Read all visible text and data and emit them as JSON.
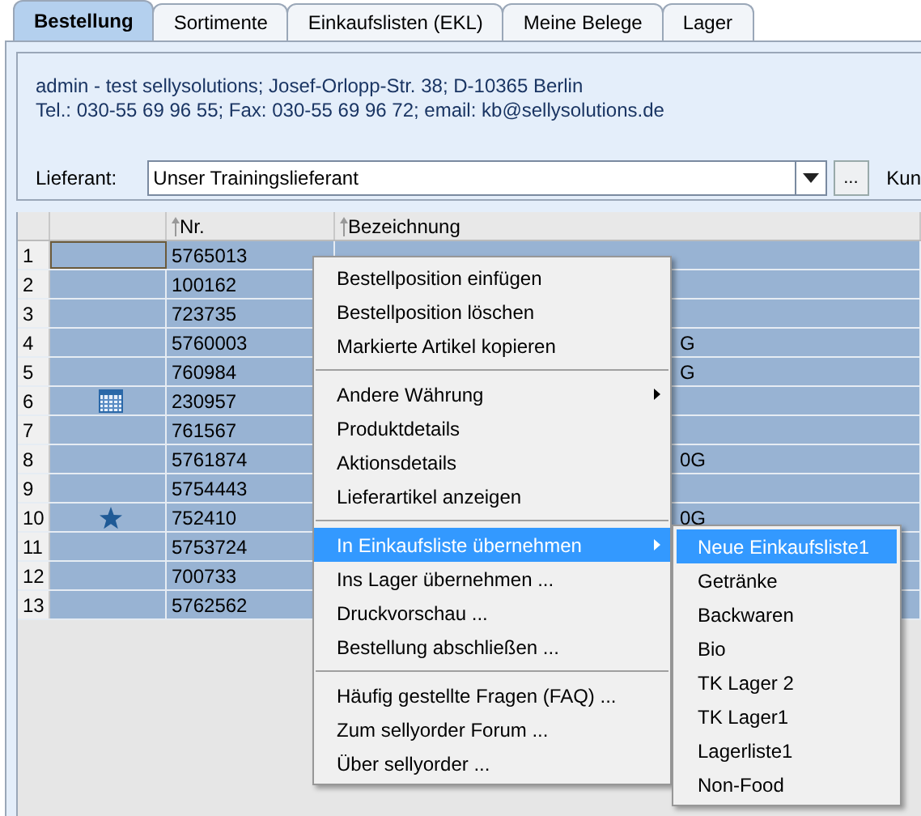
{
  "tabs": [
    {
      "label": "Bestellung",
      "selected": true
    },
    {
      "label": "Sortimente",
      "selected": false
    },
    {
      "label": "Einkaufslisten (EKL)",
      "selected": false
    },
    {
      "label": "Meine Belege",
      "selected": false
    },
    {
      "label": "Lager",
      "selected": false
    }
  ],
  "address_lines": [
    "admin - test sellysolutions; Josef-Orlopp-Str. 38; D-10365 Berlin",
    "Tel.: 030-55 69 96 55; Fax: 030-55 69 96 72; email: kb@sellysolutions.de"
  ],
  "supplier": {
    "label": "Lieferant:",
    "value": "Unser Trainingslieferant",
    "more_button": "...",
    "next_label": "Kun"
  },
  "table": {
    "columns": [
      "Nr.",
      "Bezeichnung"
    ],
    "rows": [
      {
        "row": "1",
        "nr": "5765013",
        "selected": true,
        "focused": true
      },
      {
        "row": "2",
        "nr": "100162",
        "selected": true,
        "focused": false
      },
      {
        "row": "3",
        "nr": "723735",
        "selected": true,
        "focused": false
      },
      {
        "row": "4",
        "nr": "5760003",
        "description_tail": "G",
        "selected": true,
        "focused": false
      },
      {
        "row": "5",
        "nr": "760984",
        "description_tail": "G",
        "selected": true,
        "focused": false
      },
      {
        "row": "6",
        "kind": "calendar",
        "nr": "230957",
        "selected": true,
        "focused": false
      },
      {
        "row": "7",
        "nr": "761567",
        "selected": true,
        "focused": false
      },
      {
        "row": "8",
        "nr": "5761874",
        "description_tail": "0G",
        "selected": true,
        "focused": false
      },
      {
        "row": "9",
        "nr": "5754443",
        "selected": true,
        "focused": false
      },
      {
        "row": "10",
        "kind": "star",
        "nr": "752410",
        "description_tail": "0G",
        "selected": true,
        "focused": false
      },
      {
        "row": "11",
        "nr": "5753724",
        "selected": true,
        "focused": false
      },
      {
        "row": "12",
        "nr": "700733",
        "selected": true,
        "focused": false
      },
      {
        "row": "13",
        "nr": "5762562",
        "selected": true,
        "focused": false
      }
    ]
  },
  "context_menu": {
    "items": [
      {
        "kind": "item",
        "label": "Bestellposition einfügen",
        "selected": false,
        "submenu": false
      },
      {
        "kind": "item",
        "label": "Bestellposition löschen",
        "selected": false,
        "submenu": false
      },
      {
        "kind": "item",
        "label": "Markierte Artikel kopieren",
        "selected": false,
        "submenu": false
      },
      {
        "kind": "separator"
      },
      {
        "kind": "item",
        "label": "Andere Währung",
        "selected": false,
        "submenu": true
      },
      {
        "kind": "item",
        "label": "Produktdetails",
        "selected": false,
        "submenu": false
      },
      {
        "kind": "item",
        "label": "Aktionsdetails",
        "selected": false,
        "submenu": false
      },
      {
        "kind": "item",
        "label": "Lieferartikel anzeigen",
        "selected": false,
        "submenu": false
      },
      {
        "kind": "separator"
      },
      {
        "kind": "item",
        "label": "In Einkaufsliste übernehmen",
        "selected": true,
        "submenu": true
      },
      {
        "kind": "item",
        "label": "Ins Lager übernehmen ...",
        "selected": false,
        "submenu": false
      },
      {
        "kind": "item",
        "label": "Druckvorschau ...",
        "selected": false,
        "submenu": false
      },
      {
        "kind": "item",
        "label": "Bestellung abschließen ...",
        "selected": false,
        "submenu": false
      },
      {
        "kind": "separator"
      },
      {
        "kind": "item",
        "label": "Häufig gestellte Fragen (FAQ) ...",
        "selected": false,
        "submenu": false
      },
      {
        "kind": "item",
        "label": "Zum sellyorder Forum ...",
        "selected": false,
        "submenu": false
      },
      {
        "kind": "item",
        "label": "Über sellyorder ...",
        "selected": false,
        "submenu": false
      }
    ]
  },
  "submenu": {
    "items": [
      {
        "label": "Neue Einkaufsliste1",
        "selected": true
      },
      {
        "label": "Getränke",
        "selected": false
      },
      {
        "label": "Backwaren",
        "selected": false
      },
      {
        "label": "Bio",
        "selected": false
      },
      {
        "label": "TK Lager 2",
        "selected": false
      },
      {
        "label": "TK Lager1",
        "selected": false
      },
      {
        "label": "Lagerliste1",
        "selected": false
      },
      {
        "label": "Non-Food",
        "selected": false
      }
    ]
  }
}
